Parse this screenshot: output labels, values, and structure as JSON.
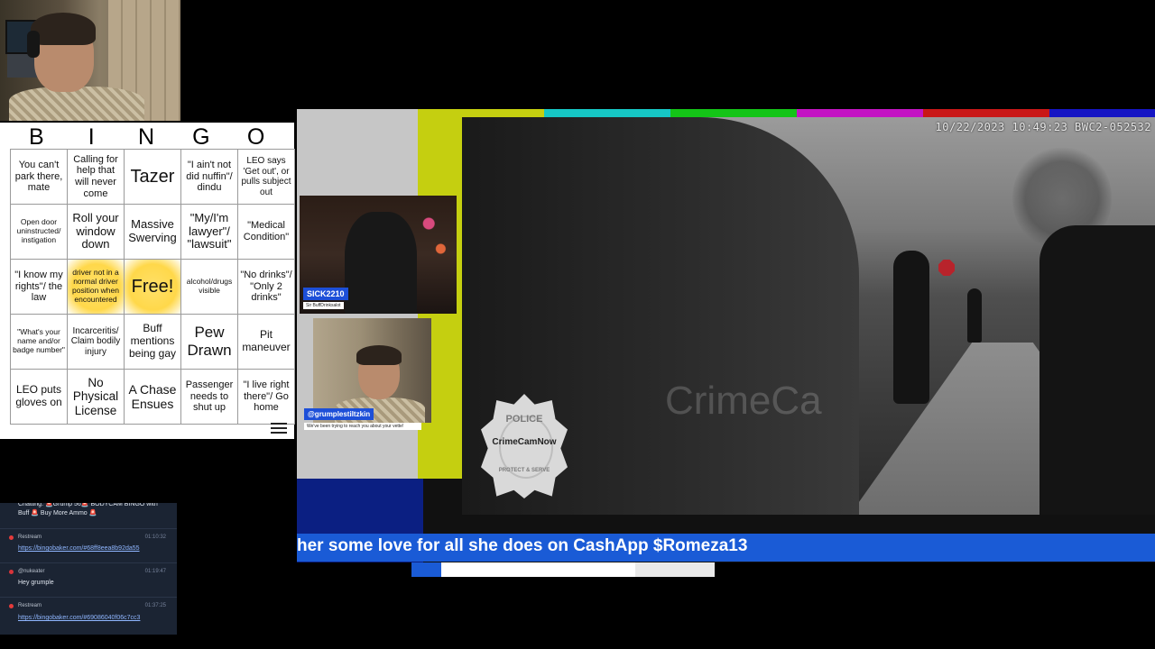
{
  "bingo": {
    "letters": [
      "B",
      "I",
      "N",
      "G",
      "O"
    ],
    "cells": [
      [
        "You can't park there, mate",
        "Calling for help that will never come",
        "Tazer",
        "\"I ain't not did nuffin\"/ dindu",
        "LEO says 'Get out', or pulls subject out"
      ],
      [
        "Open door uninstructed/ instigation",
        "Roll your window down",
        "Massive Swerving",
        "\"My/I'm lawyer\"/ \"lawsuit\"",
        "\"Medical Condition\""
      ],
      [
        "\"I know my rights\"/ the law",
        "driver not in a normal driver position when encountered",
        "Free!",
        "alcohol/drugs visible",
        "\"No drinks\"/ \"Only 2 drinks\""
      ],
      [
        "\"What's your name and/or badge number\"",
        "Incarceritis/ Claim bodily injury",
        "Buff mentions being gay",
        "Pew Drawn",
        "Pit maneuver"
      ],
      [
        "LEO puts gloves on",
        "No Physical License",
        "A Chase Ensues",
        "Passenger needs to shut up",
        "\"I live right there\"/ Go home"
      ]
    ],
    "highlighted": [
      [
        2,
        1
      ],
      [
        2,
        2
      ]
    ]
  },
  "video": {
    "timestamp": "10/22/2023 10:49:23 BWC2-052532",
    "watermark": "CrimeCa"
  },
  "badge": {
    "top": "POLICE",
    "name": "CrimeCamNow",
    "bottom": "PROTECT & SERVE"
  },
  "guests": {
    "guest1_name": "SICK2210",
    "guest1_sub": "Sir BuffDrinksalot",
    "guest2_name": "@grumplestiltzkin",
    "guest2_sub": "We've been trying to reach you about your vette!"
  },
  "ticker": {
    "text": "her some love for all she does on CashApp $Romeza13"
  },
  "chat": {
    "messages": [
      {
        "user": "",
        "time": "",
        "text": "Chatting: 🚨Grump 56🚨 BODYCAM BINGO with Buff 🚨 Buy More Ammo 🚨",
        "link": ""
      },
      {
        "user": "Restream",
        "time": "01:10:32",
        "text": "",
        "link": "https://bingobaker.com/#68ff8eea8b92da55"
      },
      {
        "user": "@nukeater",
        "time": "01:19:47",
        "text": "Hey grumple",
        "link": ""
      },
      {
        "user": "Restream",
        "time": "01:37:25",
        "text": "",
        "link": "https://bingobaker.com/#69086040f06c7cc3"
      }
    ]
  },
  "colors": {
    "ticker_bg": "#1a5bd6",
    "highlight": "#ffd84a",
    "chat_bg": "#1b2433"
  }
}
